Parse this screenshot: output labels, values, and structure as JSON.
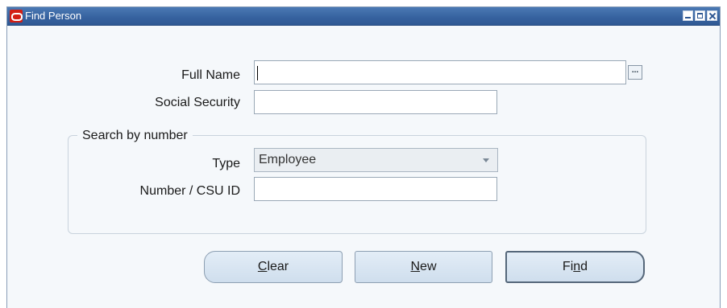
{
  "window": {
    "title": "Find Person",
    "app_icon": "oracle-icon",
    "controls": [
      "minimize-icon",
      "maximize-icon",
      "close-icon"
    ]
  },
  "form": {
    "full_name": {
      "label": "Full Name",
      "value": "",
      "lov_label": "..."
    },
    "social_security": {
      "label": "Social Security",
      "value": ""
    },
    "search_by_number": {
      "title": "Search by number",
      "type": {
        "label": "Type",
        "selected": "Employee"
      },
      "number": {
        "label": "Number / CSU ID",
        "value": ""
      }
    }
  },
  "buttons": {
    "clear": {
      "mnemonic": "C",
      "rest": "lear"
    },
    "new": {
      "mnemonic": "N",
      "rest": "ew"
    },
    "find": {
      "pre": "Fi",
      "mnemonic": "n",
      "rest": "d"
    }
  },
  "colors": {
    "titlebar": "#3763a0",
    "window_bg": "#f5f8fb",
    "button_bg": "#d9e6f2",
    "oracle_red": "#d31f14"
  }
}
